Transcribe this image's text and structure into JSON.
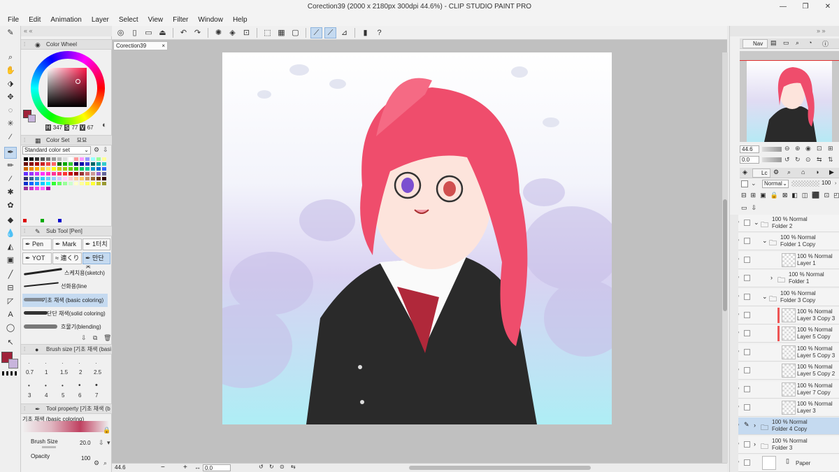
{
  "window": {
    "title": "Corection39 (2000 x 2180px 300dpi 44.6%)  - CLIP STUDIO PAINT PRO",
    "controls": [
      "—",
      "❐",
      "✕"
    ]
  },
  "menu": [
    "File",
    "Edit",
    "Animation",
    "Layer",
    "Select",
    "View",
    "Filter",
    "Window",
    "Help"
  ],
  "document": {
    "tab_label": "Corection39",
    "tab_close": "×"
  },
  "color_wheel": {
    "title": "Color Wheel",
    "h_label": "H",
    "h_value": "347",
    "s_label": "S",
    "s_value": "77",
    "v_label": "V",
    "v_value": "67",
    "main_color": "#a0223a",
    "sub_color": "#c8b4dc"
  },
  "color_set": {
    "title": "Color Set",
    "selected_set": "Standard color set",
    "small_tab": "묘묘"
  },
  "sub_tool": {
    "title": "Sub Tool [Pen]",
    "tabs": [
      "Pen",
      "Mark",
      "1터치",
      "YOT",
      "連くり",
      "만단 ᄌ"
    ],
    "brushes": [
      "스케치용(sketch)",
      "선화용(line drawing)",
      "기초 채색 (basic coloring)",
      "단단 채색(solid coloring)",
      "흐물기(blending)"
    ]
  },
  "brush_size": {
    "title": "Brush size [기초 채색 (basi",
    "row1": [
      "0.7",
      "1",
      "1.5",
      "2",
      "2.5"
    ],
    "row2": [
      "3",
      "4",
      "5",
      "6",
      "7"
    ]
  },
  "tool_property": {
    "title": "Tool property [기초 채색 (b",
    "brush_name": "기초 채색 (basic coloring)",
    "brush_size_label": "Brush Size",
    "brush_size_value": "20.0",
    "opacity_label": "Opacity",
    "opacity_value": "100"
  },
  "statusbar": {
    "zoom": "44.6",
    "angle": "0.0"
  },
  "navigator": {
    "tab_label": "Nav",
    "zoom": "44.6",
    "angle": "0.0"
  },
  "layer_panel": {
    "tab_label": "Lc",
    "blend_mode": "Normal",
    "opacity": "100",
    "layers": [
      {
        "line1": "100 % Normal",
        "line2": "Folder 2",
        "type": "folder"
      },
      {
        "line1": "100 % Normal",
        "line2": "Folder 1 Copy",
        "type": "folder"
      },
      {
        "line1": "100 % Normal",
        "line2": "Layer 1",
        "type": "layer"
      },
      {
        "line1": "100 % Normal",
        "line2": "Folder 1",
        "type": "folder"
      },
      {
        "line1": "100 % Normal",
        "line2": "Folder 3 Copy",
        "type": "folder"
      },
      {
        "line1": "100 % Normal",
        "line2": "Layer 3 Copy 3",
        "type": "layer"
      },
      {
        "line1": "100 % Normal",
        "line2": "Layer 5 Copy",
        "type": "layer"
      },
      {
        "line1": "100 % Normal",
        "line2": "Layer 5 Copy 3",
        "type": "layer"
      },
      {
        "line1": "100 % Normal",
        "line2": "Layer 5 Copy 2",
        "type": "layer"
      },
      {
        "line1": "100 % Normal",
        "line2": "Layer 7 Copy",
        "type": "layer"
      },
      {
        "line1": "100 % Normal",
        "line2": "Layer 3",
        "type": "layer"
      },
      {
        "line1": "100 % Normal",
        "line2": "Folder 4 Copy",
        "type": "folder"
      },
      {
        "line1": "100 % Normal",
        "line2": "Folder 3",
        "type": "folder"
      },
      {
        "line1": "",
        "line2": "Paper",
        "type": "paper"
      }
    ]
  }
}
